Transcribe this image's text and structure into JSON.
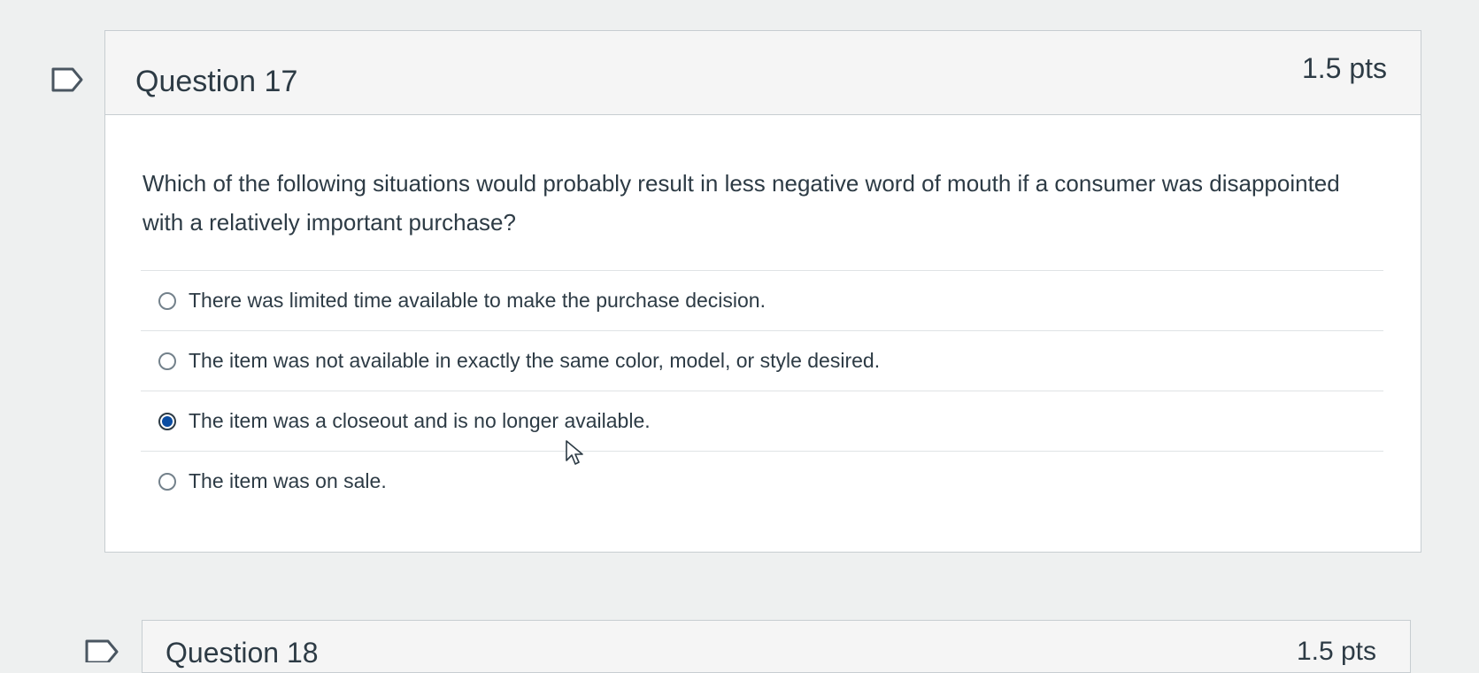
{
  "question": {
    "title": "Question 17",
    "points": "1.5 pts",
    "text": "Which of the following situations would probably result in less negative word of mouth if a consumer was disappointed with a relatively important purchase?",
    "answers": [
      {
        "label": "There was limited time available to make the purchase decision.",
        "selected": false
      },
      {
        "label": "The item was not available in exactly the same color, model, or style desired.",
        "selected": false
      },
      {
        "label": "The item was a closeout and is no longer available.",
        "selected": true
      },
      {
        "label": "The item was on sale.",
        "selected": false
      }
    ]
  },
  "next_question": {
    "title": "Question 18",
    "points": "1.5 pts"
  },
  "colors": {
    "selected_radio": "#0b4da2",
    "text": "#2d3b45",
    "header_bg": "#f5f5f5"
  },
  "icons": {
    "flag": "flag-outline-icon",
    "cursor": "mouse-pointer-icon"
  }
}
